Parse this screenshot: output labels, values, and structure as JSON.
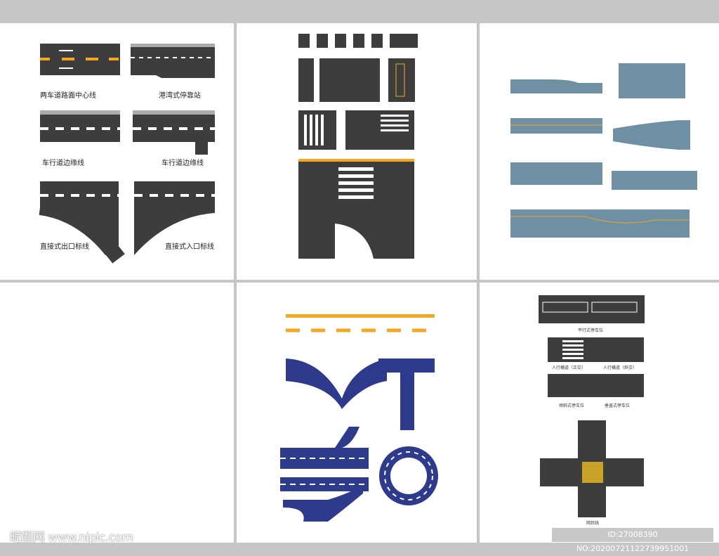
{
  "panel1": {
    "labels": [
      "两车道路面中心线",
      "港湾式停靠站",
      "车行道边缘线",
      "车行道边缘线",
      "直接式出口标线",
      "直接式入口标线"
    ]
  },
  "panel6": {
    "labels": [
      "平行式停车位",
      "人行横道（正交）",
      "人行横道（斜交）",
      "倾斜式停车位",
      "垂直式停车位",
      "网状线"
    ]
  },
  "watermark": {
    "site": "昵图网 www.nipic.com",
    "id": "ID:27008390 NO:20200721122739951001"
  },
  "colors": {
    "asphalt": "#3d3d3d",
    "marking_yellow": "#f5a623",
    "blue_road": "#2e3a8c",
    "grey_road": "#6f8fa3",
    "background": "#c6c6c6"
  }
}
